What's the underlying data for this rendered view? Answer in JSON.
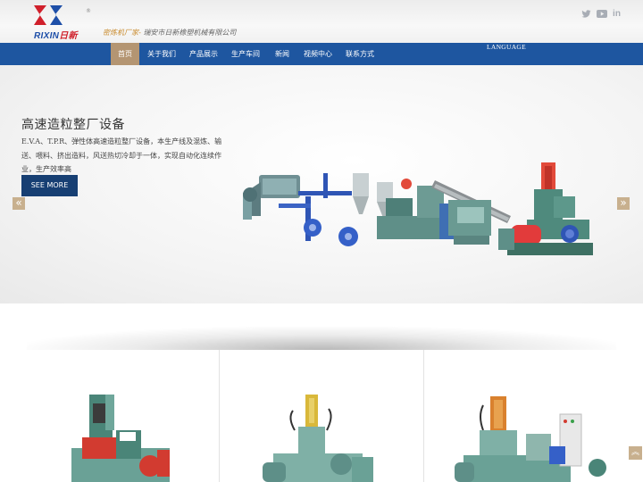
{
  "header": {
    "logo": {
      "text_latin": "RIXIN",
      "text_cn": "日新",
      "reg_mark": "®"
    },
    "tagline_accent": "密炼机厂家-",
    "tagline_company": "瑞安市日新橡塑机械有限公司",
    "social": [
      {
        "icon": "twitter-icon",
        "glyph": "🐦"
      },
      {
        "icon": "youtube-icon",
        "glyph": "▶"
      },
      {
        "icon": "linkedin-icon",
        "glyph": "in"
      }
    ]
  },
  "nav": {
    "items": [
      {
        "label": "首页",
        "active": true
      },
      {
        "label": "关于我们"
      },
      {
        "label": "产品展示"
      },
      {
        "label": "生产车间"
      },
      {
        "label": "新闻"
      },
      {
        "label": "视频中心"
      },
      {
        "label": "联系方式"
      }
    ],
    "language_label": "LANGUAGE"
  },
  "hero": {
    "title": "高速造粒整厂设备",
    "description": "E.V.A、T.P.R、弹性体高速造粒整厂设备，本生产线及混炼、输送、喂料、挤出造料，风送热切冷却于一体，实现自动化连续作业，生产效率高",
    "button_label": "SEE MORE",
    "prev_glyph": "«",
    "next_glyph": "»"
  },
  "back_to_top_glyph": "︽",
  "colors": {
    "nav_bg": "#1e56a0",
    "nav_active": "#b49572",
    "button_bg": "#173f73",
    "arrow_bg": "#c8b08e",
    "machine_green": "#5a8f86",
    "machine_blue": "#2f55b5"
  }
}
